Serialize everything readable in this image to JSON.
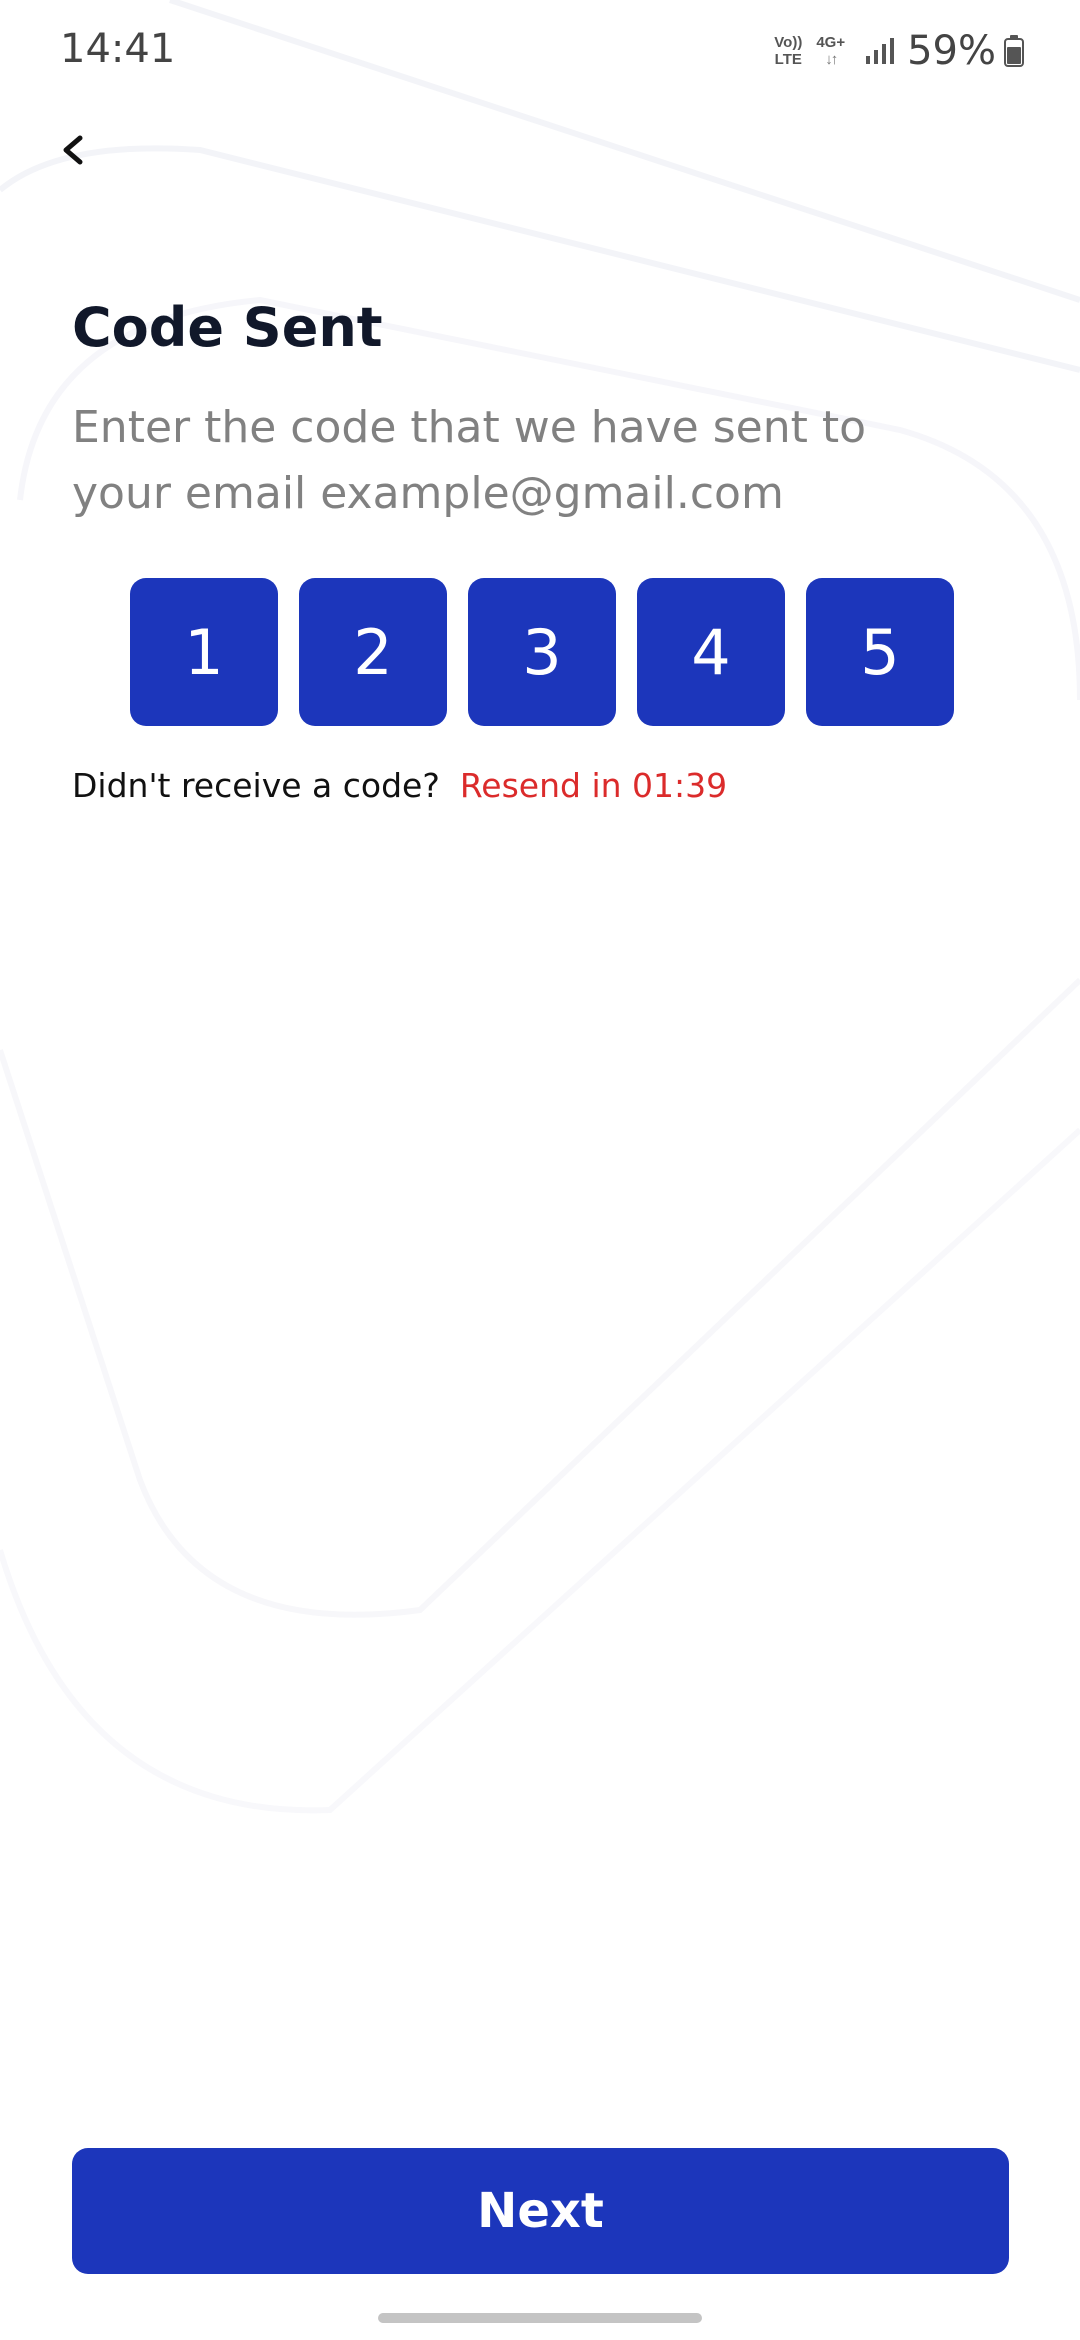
{
  "status_bar": {
    "time": "14:41",
    "volte_top": "Vo))",
    "volte_bottom": "LTE",
    "network_type": "4G+",
    "battery_percent": "59%",
    "signal_icon": "signal-bars-icon",
    "battery_icon": "battery-icon"
  },
  "header": {
    "back_icon": "chevron-left-icon"
  },
  "main": {
    "title": "Code Sent",
    "subtitle": "Enter the code that we have sent to your email example@gmail.com",
    "otp_digits": [
      "1",
      "2",
      "3",
      "4",
      "5"
    ],
    "resend_prompt": "Didn't receive a code?",
    "resend_timer": "Resend in 01:39"
  },
  "footer": {
    "next_label": "Next"
  },
  "colors": {
    "primary": "#1C36BB",
    "timer_red": "#DB2B2B",
    "title_text": "#11182A",
    "subtitle_text": "#818181"
  }
}
